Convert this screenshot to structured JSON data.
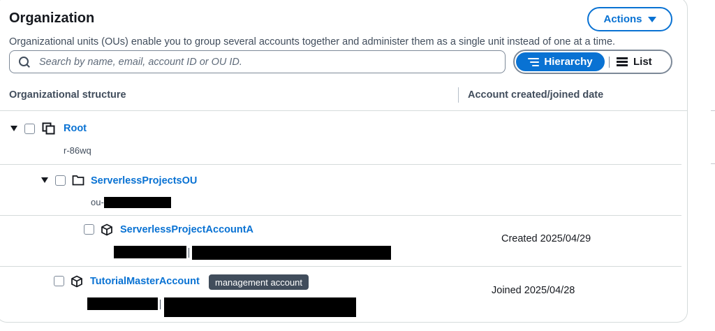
{
  "header": {
    "title": "Organization",
    "description": "Organizational units (OUs) enable you to group several accounts together and administer them as a single unit instead of one at a time.",
    "actions_label": "Actions"
  },
  "search": {
    "placeholder": "Search by name, email, account ID or OU ID.",
    "value": ""
  },
  "view_toggle": {
    "options": [
      "Hierarchy",
      "List"
    ],
    "selected": "Hierarchy"
  },
  "table": {
    "columns": [
      "Organizational structure",
      "Account created/joined date"
    ],
    "rows": [
      {
        "type": "root",
        "name": "Root",
        "id": "r-86wq",
        "date": "",
        "expanded": true
      },
      {
        "type": "ou",
        "name": "ServerlessProjectsOU",
        "id_prefix": "ou-",
        "date": "",
        "expanded": true
      },
      {
        "type": "account",
        "name": "ServerlessProjectAccountA",
        "date": "Created 2025/04/29",
        "badge": ""
      },
      {
        "type": "account",
        "name": "TutorialMasterAccount",
        "date": "Joined 2025/04/28",
        "badge": "management account"
      }
    ]
  },
  "colors": {
    "accent": "#0972d3",
    "text": "#16191f",
    "muted": "#414d5c",
    "border": "#d5dbdb"
  },
  "icons": [
    "search-icon",
    "caret-down-icon",
    "hierarchy-icon",
    "list-icon",
    "organization-root-icon",
    "folder-icon",
    "account-cube-icon"
  ]
}
